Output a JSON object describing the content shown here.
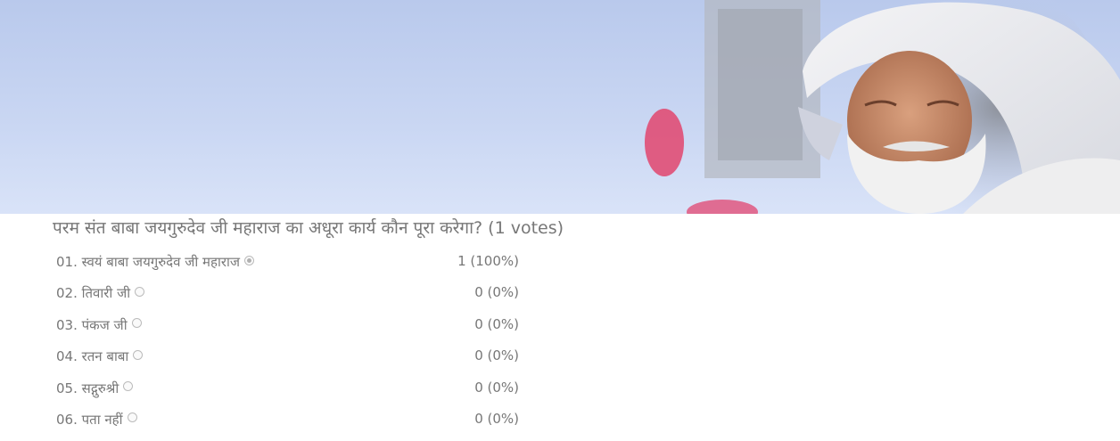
{
  "banner": {
    "image": "portrait-of-elderly-man-with-white-turban-and-beard"
  },
  "poll": {
    "question": "परम संत बाबा जयगुरुदेव जी महाराज का अधूरा कार्य कौन पूरा करेगा? (1 votes)",
    "options": [
      {
        "label": "01. स्वयं बाबा जयगुरुदेव जी महाराज",
        "result": "1 (100%)",
        "selected": true
      },
      {
        "label": "02. तिवारी जी",
        "result": "0 (0%)",
        "selected": false
      },
      {
        "label": "03. पंकज जी",
        "result": "0 (0%)",
        "selected": false
      },
      {
        "label": "04. रतन बाबा",
        "result": "0 (0%)",
        "selected": false
      },
      {
        "label": "05. सद्गुरुश्री",
        "result": "0 (0%)",
        "selected": false
      },
      {
        "label": "06. पता नहीं",
        "result": "0 (0%)",
        "selected": false
      }
    ]
  }
}
